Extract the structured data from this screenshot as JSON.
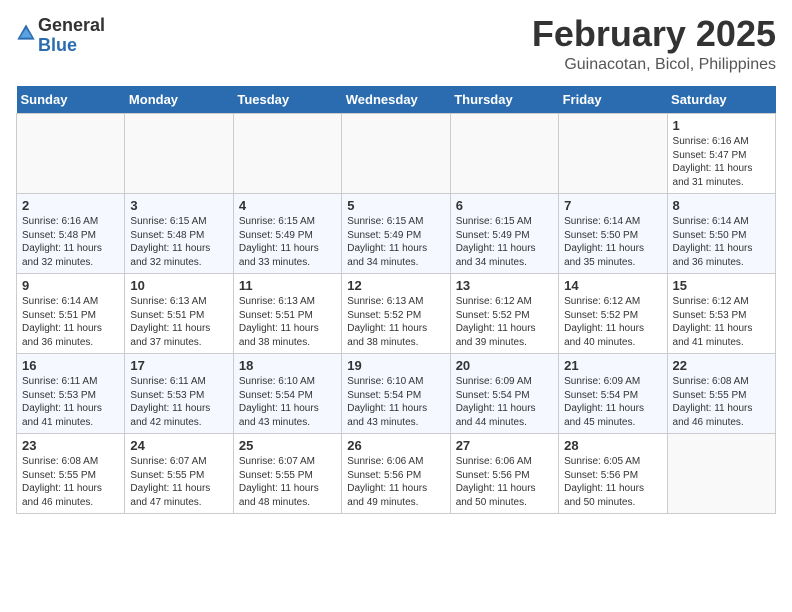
{
  "header": {
    "logo_general": "General",
    "logo_blue": "Blue",
    "title": "February 2025",
    "subtitle": "Guinacotan, Bicol, Philippines"
  },
  "weekdays": [
    "Sunday",
    "Monday",
    "Tuesday",
    "Wednesday",
    "Thursday",
    "Friday",
    "Saturday"
  ],
  "weeks": [
    [
      {
        "day": "",
        "info": ""
      },
      {
        "day": "",
        "info": ""
      },
      {
        "day": "",
        "info": ""
      },
      {
        "day": "",
        "info": ""
      },
      {
        "day": "",
        "info": ""
      },
      {
        "day": "",
        "info": ""
      },
      {
        "day": "1",
        "info": "Sunrise: 6:16 AM\nSunset: 5:47 PM\nDaylight: 11 hours\nand 31 minutes."
      }
    ],
    [
      {
        "day": "2",
        "info": "Sunrise: 6:16 AM\nSunset: 5:48 PM\nDaylight: 11 hours\nand 32 minutes."
      },
      {
        "day": "3",
        "info": "Sunrise: 6:15 AM\nSunset: 5:48 PM\nDaylight: 11 hours\nand 32 minutes."
      },
      {
        "day": "4",
        "info": "Sunrise: 6:15 AM\nSunset: 5:49 PM\nDaylight: 11 hours\nand 33 minutes."
      },
      {
        "day": "5",
        "info": "Sunrise: 6:15 AM\nSunset: 5:49 PM\nDaylight: 11 hours\nand 34 minutes."
      },
      {
        "day": "6",
        "info": "Sunrise: 6:15 AM\nSunset: 5:49 PM\nDaylight: 11 hours\nand 34 minutes."
      },
      {
        "day": "7",
        "info": "Sunrise: 6:14 AM\nSunset: 5:50 PM\nDaylight: 11 hours\nand 35 minutes."
      },
      {
        "day": "8",
        "info": "Sunrise: 6:14 AM\nSunset: 5:50 PM\nDaylight: 11 hours\nand 36 minutes."
      }
    ],
    [
      {
        "day": "9",
        "info": "Sunrise: 6:14 AM\nSunset: 5:51 PM\nDaylight: 11 hours\nand 36 minutes."
      },
      {
        "day": "10",
        "info": "Sunrise: 6:13 AM\nSunset: 5:51 PM\nDaylight: 11 hours\nand 37 minutes."
      },
      {
        "day": "11",
        "info": "Sunrise: 6:13 AM\nSunset: 5:51 PM\nDaylight: 11 hours\nand 38 minutes."
      },
      {
        "day": "12",
        "info": "Sunrise: 6:13 AM\nSunset: 5:52 PM\nDaylight: 11 hours\nand 38 minutes."
      },
      {
        "day": "13",
        "info": "Sunrise: 6:12 AM\nSunset: 5:52 PM\nDaylight: 11 hours\nand 39 minutes."
      },
      {
        "day": "14",
        "info": "Sunrise: 6:12 AM\nSunset: 5:52 PM\nDaylight: 11 hours\nand 40 minutes."
      },
      {
        "day": "15",
        "info": "Sunrise: 6:12 AM\nSunset: 5:53 PM\nDaylight: 11 hours\nand 41 minutes."
      }
    ],
    [
      {
        "day": "16",
        "info": "Sunrise: 6:11 AM\nSunset: 5:53 PM\nDaylight: 11 hours\nand 41 minutes."
      },
      {
        "day": "17",
        "info": "Sunrise: 6:11 AM\nSunset: 5:53 PM\nDaylight: 11 hours\nand 42 minutes."
      },
      {
        "day": "18",
        "info": "Sunrise: 6:10 AM\nSunset: 5:54 PM\nDaylight: 11 hours\nand 43 minutes."
      },
      {
        "day": "19",
        "info": "Sunrise: 6:10 AM\nSunset: 5:54 PM\nDaylight: 11 hours\nand 43 minutes."
      },
      {
        "day": "20",
        "info": "Sunrise: 6:09 AM\nSunset: 5:54 PM\nDaylight: 11 hours\nand 44 minutes."
      },
      {
        "day": "21",
        "info": "Sunrise: 6:09 AM\nSunset: 5:54 PM\nDaylight: 11 hours\nand 45 minutes."
      },
      {
        "day": "22",
        "info": "Sunrise: 6:08 AM\nSunset: 5:55 PM\nDaylight: 11 hours\nand 46 minutes."
      }
    ],
    [
      {
        "day": "23",
        "info": "Sunrise: 6:08 AM\nSunset: 5:55 PM\nDaylight: 11 hours\nand 46 minutes."
      },
      {
        "day": "24",
        "info": "Sunrise: 6:07 AM\nSunset: 5:55 PM\nDaylight: 11 hours\nand 47 minutes."
      },
      {
        "day": "25",
        "info": "Sunrise: 6:07 AM\nSunset: 5:55 PM\nDaylight: 11 hours\nand 48 minutes."
      },
      {
        "day": "26",
        "info": "Sunrise: 6:06 AM\nSunset: 5:56 PM\nDaylight: 11 hours\nand 49 minutes."
      },
      {
        "day": "27",
        "info": "Sunrise: 6:06 AM\nSunset: 5:56 PM\nDaylight: 11 hours\nand 50 minutes."
      },
      {
        "day": "28",
        "info": "Sunrise: 6:05 AM\nSunset: 5:56 PM\nDaylight: 11 hours\nand 50 minutes."
      },
      {
        "day": "",
        "info": ""
      }
    ]
  ]
}
